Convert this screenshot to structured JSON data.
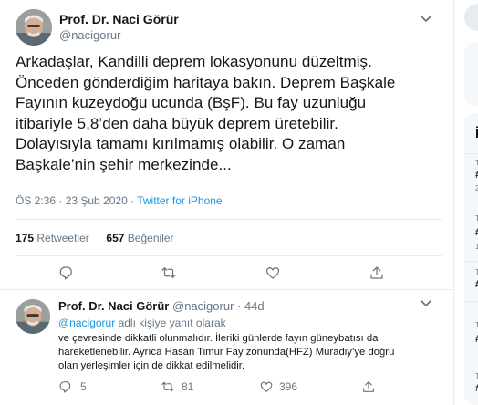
{
  "main_tweet": {
    "author_name": "Prof. Dr. Naci Görür",
    "author_handle": "@nacigorur",
    "text_lines": [
      "Arkadaşlar, Kandilli deprem lokasyonunu düzeltmiş.",
      "Önceden gönderdiğim haritaya bakın. Deprem Başkale",
      "Fayının kuzeydoğu ucunda (BşF). Bu fay uzunluğu",
      "itibariyle 5,8’den daha büyük deprem üretebilir.",
      "Dolayısıyla tamamı kırılmamış olabilir. O zaman",
      "Başkale’nin şehir merkezinde..."
    ],
    "time": "ÖS 2:36 · 23 Şub 2020 ·",
    "source": "Twitter for iPhone",
    "retweets_count": "175",
    "retweets_label": "Retweetler",
    "likes_count": "657",
    "likes_label": "Beğeniler"
  },
  "reply_tweet": {
    "author_name": "Prof. Dr. Naci Görür",
    "author_handle": "@nacigorur · 44d",
    "reply_mention": "@nacigorur",
    "reply_suffix": "adlı kişiye yanıt olarak",
    "text_lines": [
      "ve çevresinde dikkatli olunmalıdır. İleriki günlerde fayın güneybatısı da",
      "hareketlenebilir. Ayrıca Hasan Timur Fay zonunda(HFZ) Muradiy’ye doğru",
      "olan yerleşimler için de dikkat edilmelidir."
    ],
    "reply_count": "5",
    "retweet_count": "81",
    "like_count": "396"
  },
  "sidebar_fragments": {
    "header_letter": "İ",
    "items": [
      "T",
      "#",
      "2",
      "T",
      "#",
      "1",
      "T",
      "#",
      "T",
      "#",
      "T",
      "#"
    ]
  },
  "icons": {
    "caret": "chevron-down-icon",
    "reply": "reply-icon",
    "retweet": "retweet-icon",
    "like": "heart-icon",
    "share": "share-icon"
  },
  "colors": {
    "link": "#1b95e0",
    "secondary_text": "#657786",
    "border": "#e6ecf0"
  }
}
